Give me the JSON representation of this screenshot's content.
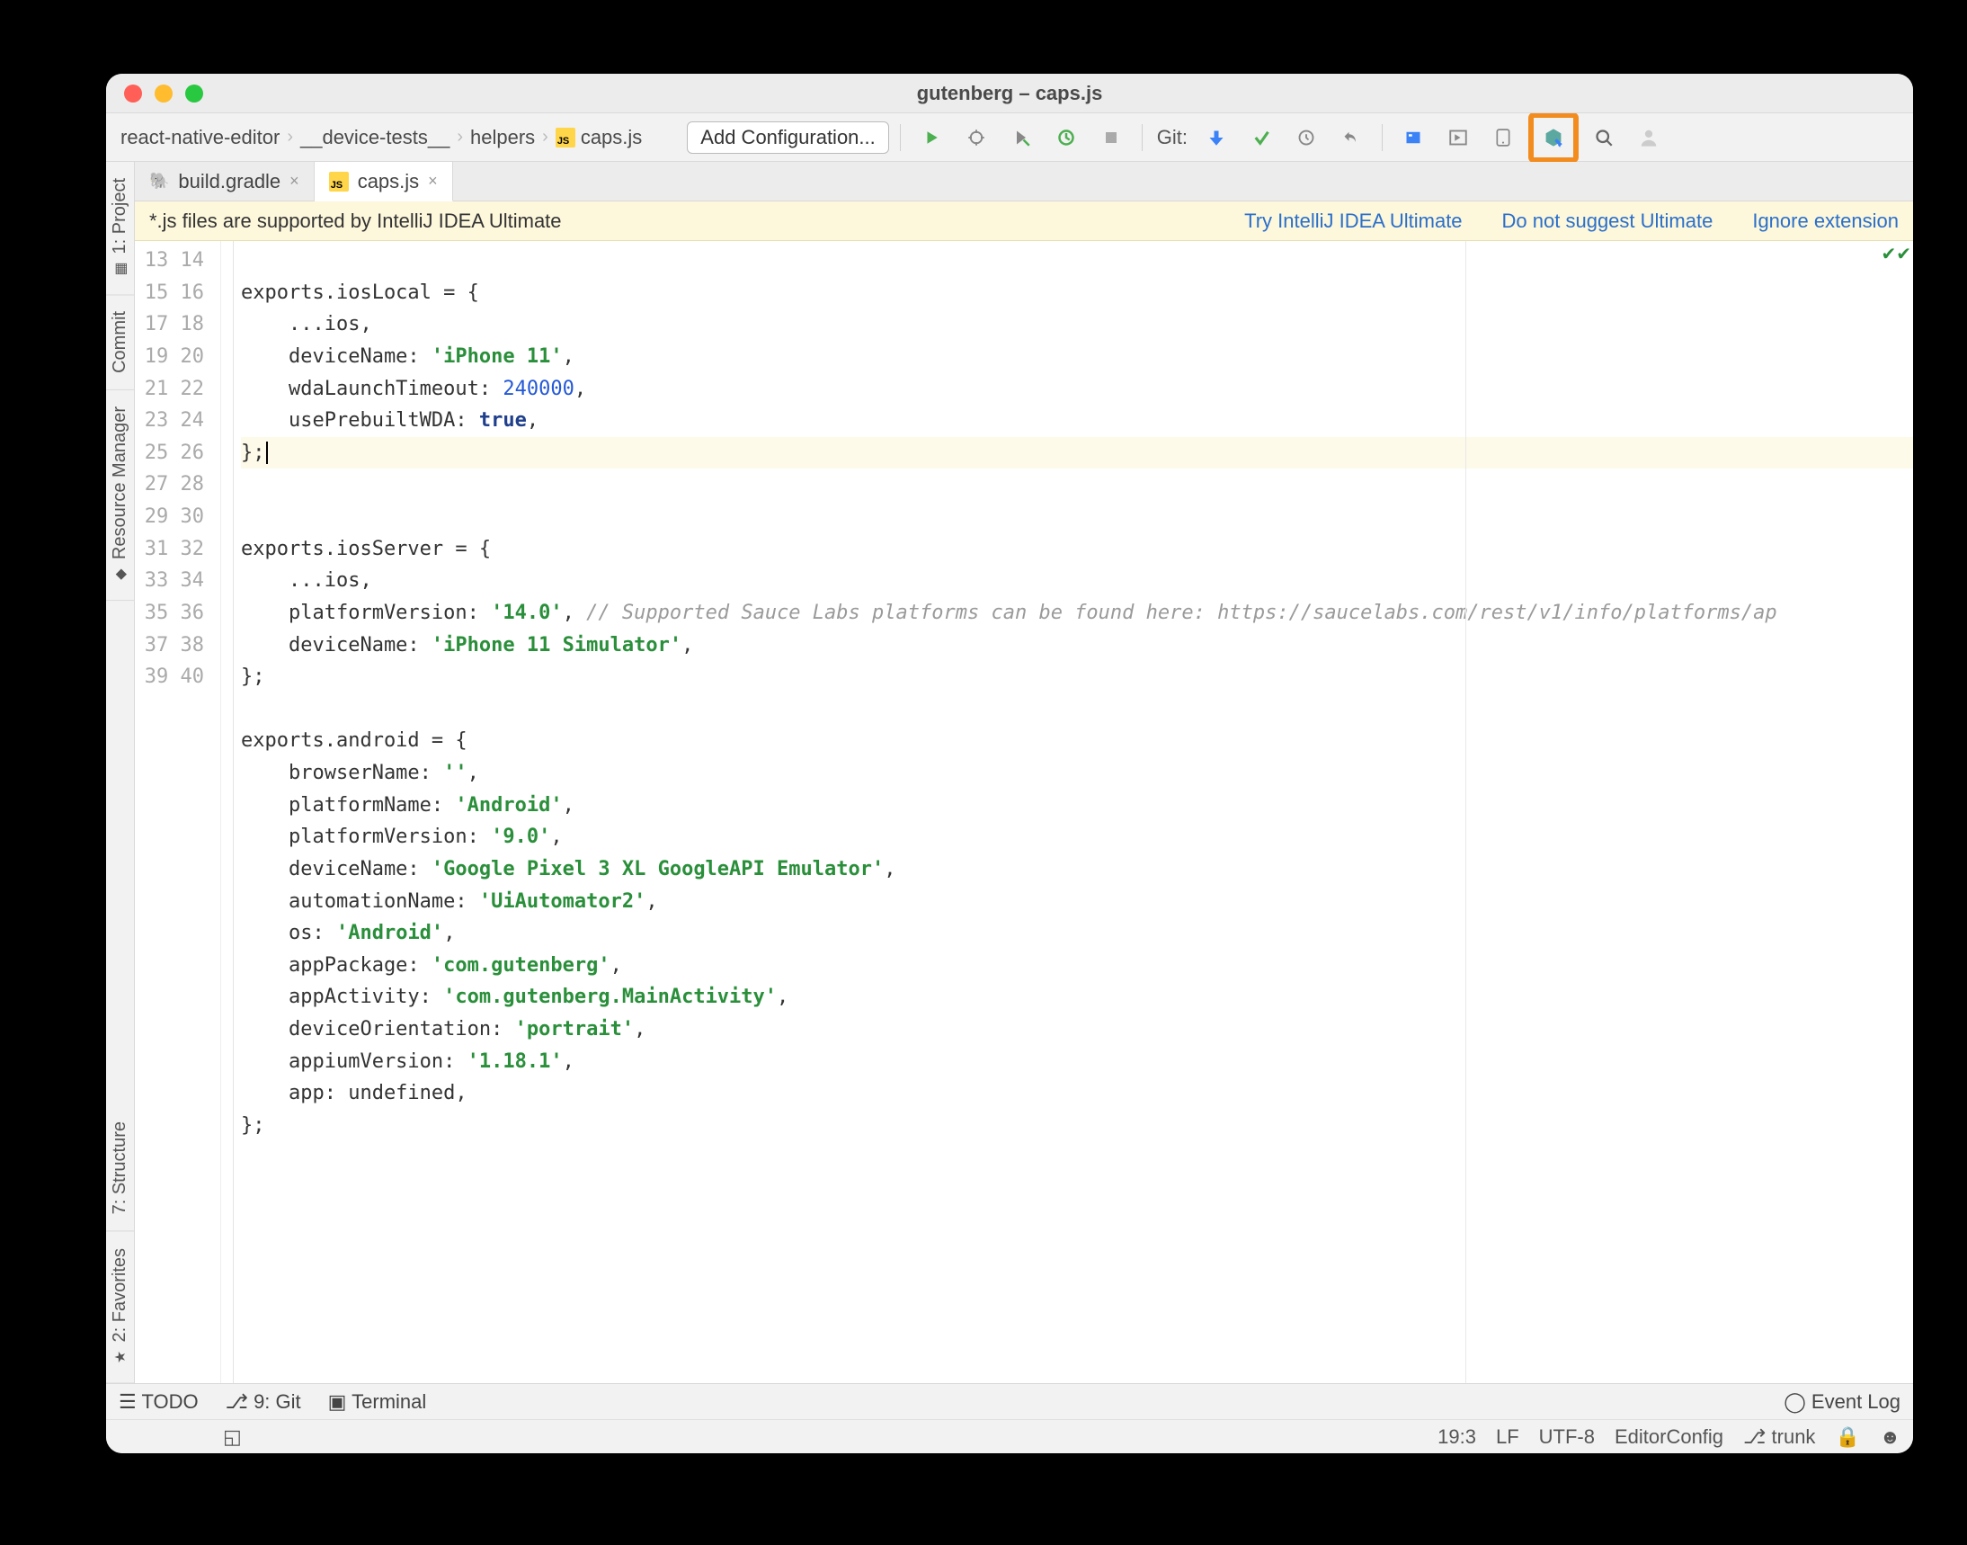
{
  "window_title": "gutenberg – caps.js",
  "breadcrumbs": [
    "react-native-editor",
    "__device-tests__",
    "helpers",
    "caps.js"
  ],
  "config_button": "Add Configuration...",
  "git_label": "Git:",
  "tabs": [
    {
      "label": "build.gradle",
      "active": false
    },
    {
      "label": "caps.js",
      "active": true
    }
  ],
  "banner": {
    "text": "*.js files are supported by IntelliJ IDEA Ultimate",
    "links": [
      "Try IntelliJ IDEA Ultimate",
      "Do not suggest Ultimate",
      "Ignore extension"
    ]
  },
  "side_tabs": [
    "1: Project",
    "Commit",
    "Resource Manager",
    "7: Structure",
    "2: Favorites"
  ],
  "gutter_start": 13,
  "gutter_end": 40,
  "code_lines": [
    {
      "n": 13,
      "raw": ""
    },
    {
      "n": 14,
      "raw": "exports.iosLocal = {"
    },
    {
      "n": 15,
      "raw": "    ...ios,"
    },
    {
      "n": 16,
      "raw": "    deviceName: 'iPhone 11',",
      "str": "'iPhone 11'"
    },
    {
      "n": 17,
      "raw": "    wdaLaunchTimeout: 240000,",
      "num": "240000"
    },
    {
      "n": 18,
      "raw": "    usePrebuiltWDA: true,",
      "kw": "true"
    },
    {
      "n": 19,
      "raw": "};",
      "hl": true,
      "caret": true
    },
    {
      "n": 20,
      "raw": ""
    },
    {
      "n": 21,
      "raw": "exports.iosServer = {"
    },
    {
      "n": 22,
      "raw": "    ...ios,"
    },
    {
      "n": 23,
      "raw": "    platformVersion: '14.0', // Supported Sauce Labs platforms can be found here: https://saucelabs.com/rest/v1/info/platforms/ap",
      "str": "'14.0'",
      "comment": "// Supported Sauce Labs platforms can be found here: https://saucelabs.com/rest/v1/info/platforms/ap"
    },
    {
      "n": 24,
      "raw": "    deviceName: 'iPhone 11 Simulator',",
      "str": "'iPhone 11 Simulator'"
    },
    {
      "n": 25,
      "raw": "};"
    },
    {
      "n": 26,
      "raw": ""
    },
    {
      "n": 27,
      "raw": "exports.android = {"
    },
    {
      "n": 28,
      "raw": "    browserName: '',",
      "str": "''"
    },
    {
      "n": 29,
      "raw": "    platformName: 'Android',",
      "str": "'Android'"
    },
    {
      "n": 30,
      "raw": "    platformVersion: '9.0',",
      "str": "'9.0'"
    },
    {
      "n": 31,
      "raw": "    deviceName: 'Google Pixel 3 XL GoogleAPI Emulator',",
      "str": "'Google Pixel 3 XL GoogleAPI Emulator'"
    },
    {
      "n": 32,
      "raw": "    automationName: 'UiAutomator2',",
      "str": "'UiAutomator2'"
    },
    {
      "n": 33,
      "raw": "    os: 'Android',",
      "str": "'Android'"
    },
    {
      "n": 34,
      "raw": "    appPackage: 'com.gutenberg',",
      "str": "'com.gutenberg'"
    },
    {
      "n": 35,
      "raw": "    appActivity: 'com.gutenberg.MainActivity',",
      "str": "'com.gutenberg.MainActivity'"
    },
    {
      "n": 36,
      "raw": "    deviceOrientation: 'portrait',",
      "str": "'portrait'"
    },
    {
      "n": 37,
      "raw": "    appiumVersion: '1.18.1',",
      "str": "'1.18.1'"
    },
    {
      "n": 38,
      "raw": "    app: undefined,"
    },
    {
      "n": 39,
      "raw": "};"
    },
    {
      "n": 40,
      "raw": ""
    }
  ],
  "bottom": {
    "todo": "TODO",
    "git": "9: Git",
    "terminal": "Terminal",
    "event_log": "Event Log"
  },
  "status": {
    "pos": "19:3",
    "le": "LF",
    "enc": "UTF-8",
    "cfg": "EditorConfig",
    "branch": "trunk"
  }
}
